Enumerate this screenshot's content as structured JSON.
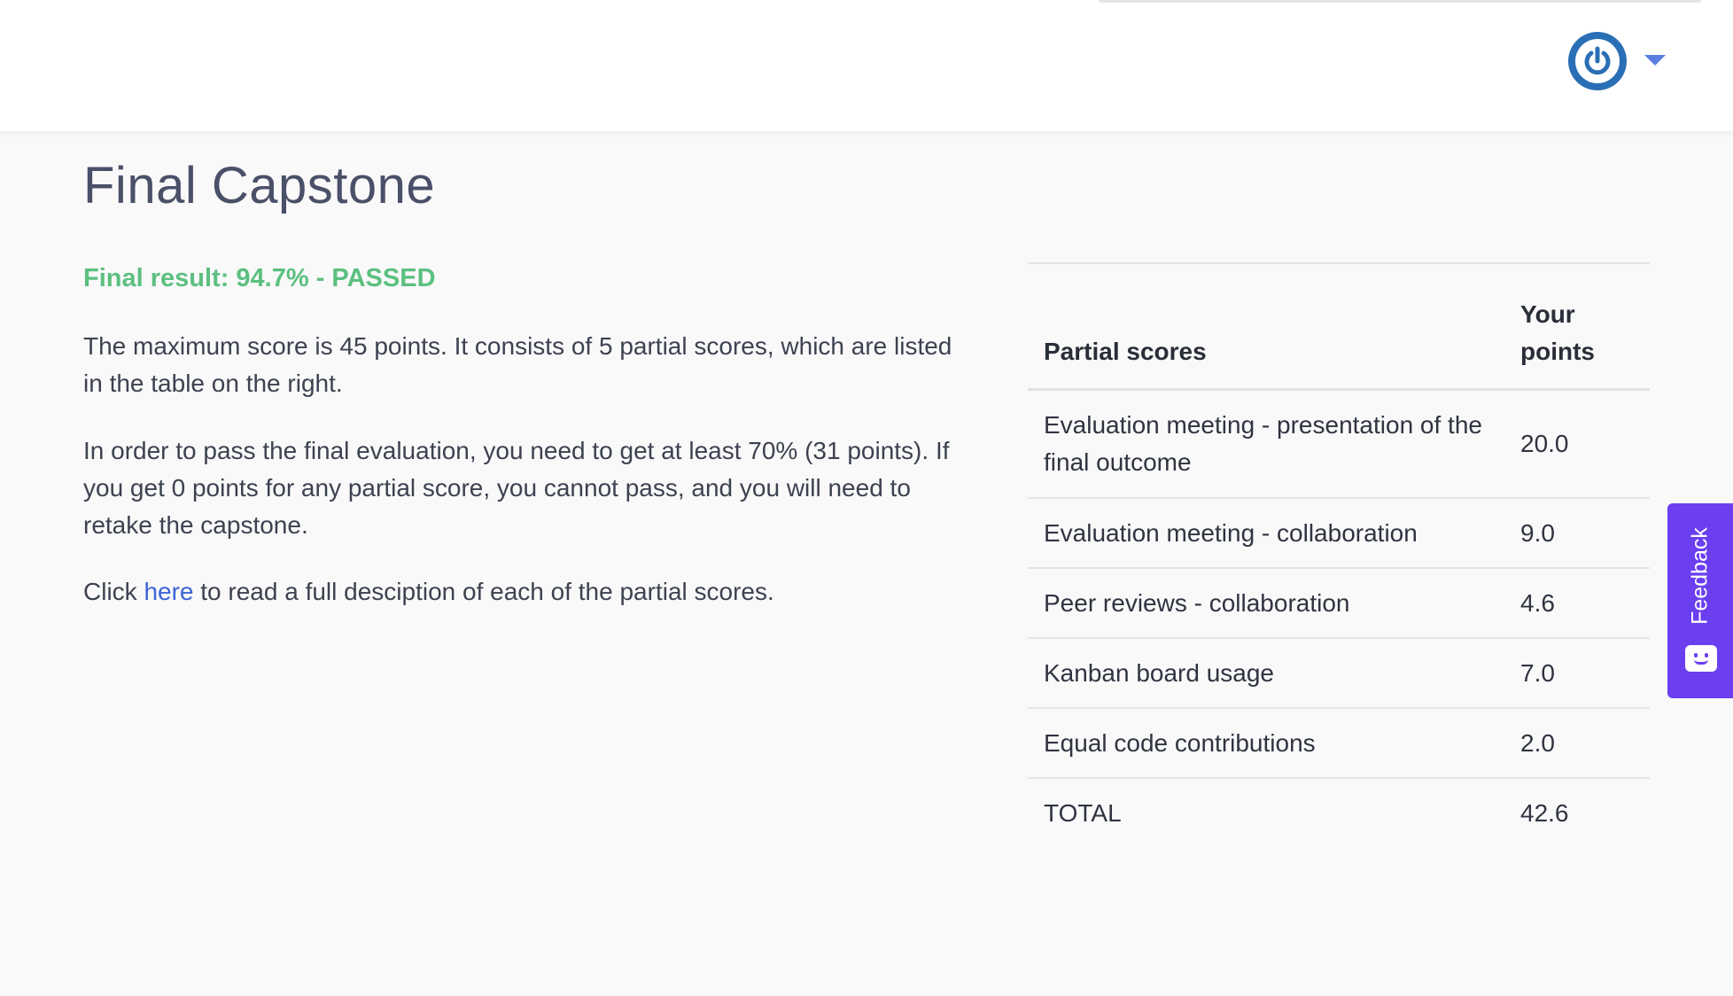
{
  "header": {
    "avatar_icon": "power-icon",
    "menu_icon": "chevron-down-icon"
  },
  "page": {
    "title": "Final Capstone",
    "result": "Final result: 94.7% - PASSED",
    "paragraph1": "The maximum score is 45 points. It consists of 5 partial scores, which are listed in the table on the right.",
    "paragraph2": "In order to pass the final evaluation, you need to get at least 70% (31 points). If you get 0 points for any partial score, you cannot pass, and you will need to retake the capstone.",
    "paragraph3_before": "Click ",
    "paragraph3_link": "here",
    "paragraph3_after": " to read a full desciption of each of the partial scores."
  },
  "scores_table": {
    "headers": [
      "Partial scores",
      "Your points"
    ],
    "rows": [
      {
        "name": "Evaluation meeting - presentation of the final outcome",
        "points": "20.0"
      },
      {
        "name": "Evaluation meeting - collaboration",
        "points": "9.0"
      },
      {
        "name": "Peer reviews - collaboration",
        "points": "4.6"
      },
      {
        "name": "Kanban board usage",
        "points": "7.0"
      },
      {
        "name": "Equal code contributions",
        "points": "2.0"
      },
      {
        "name": "TOTAL",
        "points": "42.6"
      }
    ]
  },
  "feedback": {
    "label": "Feedback",
    "icon": "smiley-chat-icon"
  },
  "colors": {
    "accent_green": "#5cc07f",
    "link_blue": "#3b64d6",
    "feedback_purple": "#6b3ef0",
    "avatar_blue": "#2a6fb5"
  }
}
